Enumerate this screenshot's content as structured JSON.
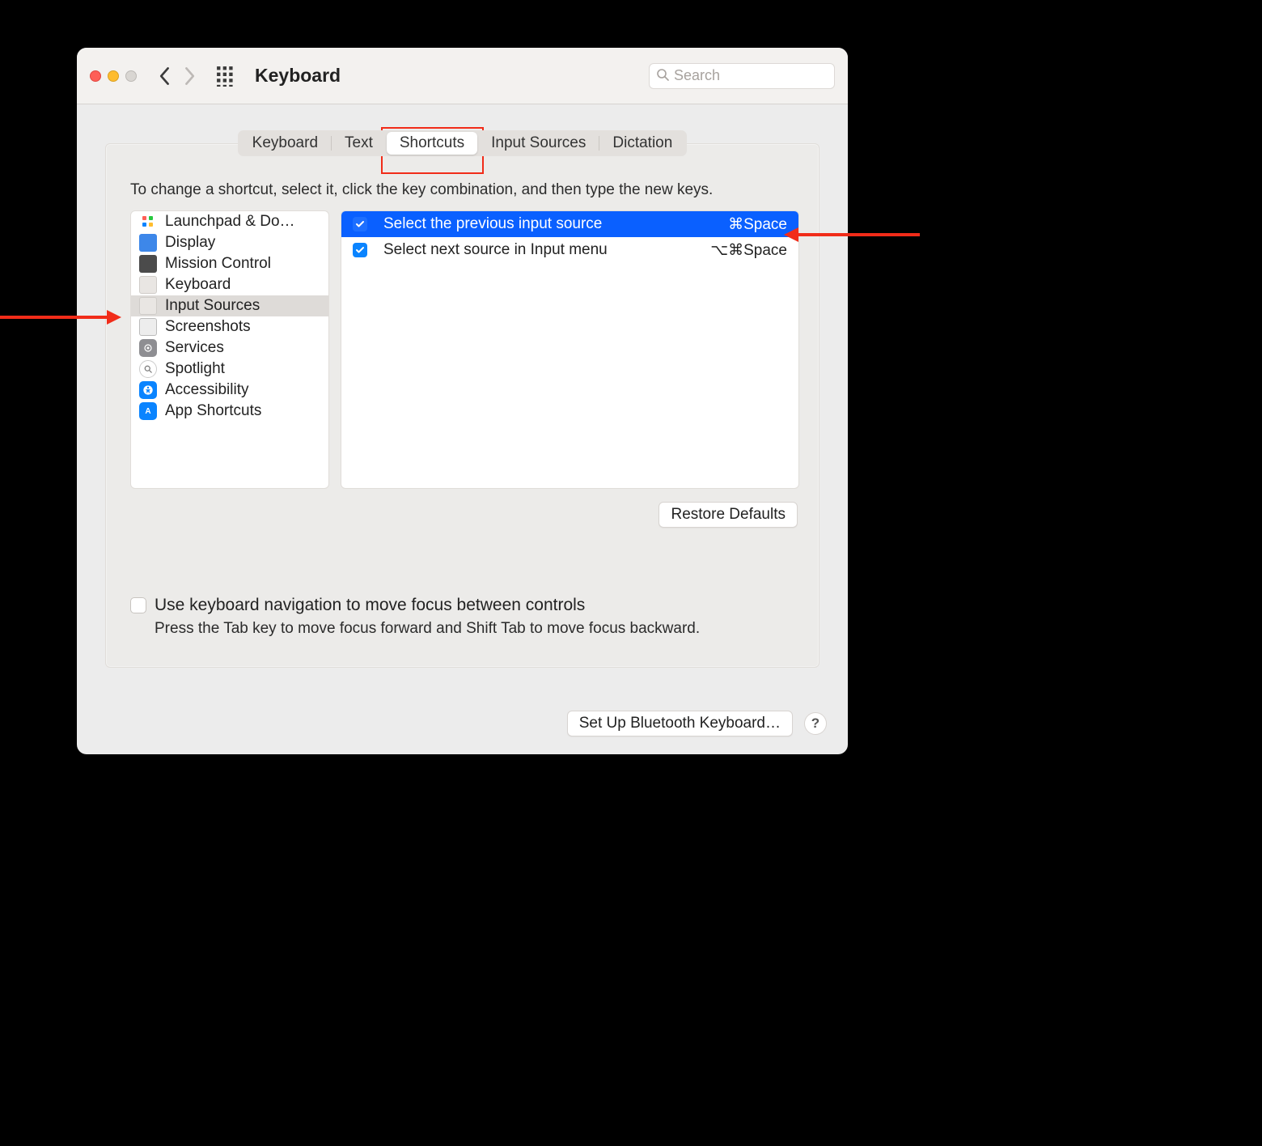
{
  "window": {
    "title": "Keyboard"
  },
  "search": {
    "placeholder": "Search"
  },
  "tabs": [
    {
      "label": "Keyboard",
      "selected": false
    },
    {
      "label": "Text",
      "selected": false
    },
    {
      "label": "Shortcuts",
      "selected": true
    },
    {
      "label": "Input Sources",
      "selected": false
    },
    {
      "label": "Dictation",
      "selected": false
    }
  ],
  "instruction": "To change a shortcut, select it, click the key combination, and then type the new keys.",
  "sidebar": {
    "items": [
      {
        "label": "Launchpad & Do…",
        "icon": "launchpad",
        "selected": false
      },
      {
        "label": "Display",
        "icon": "display",
        "selected": false
      },
      {
        "label": "Mission Control",
        "icon": "mc",
        "selected": false
      },
      {
        "label": "Keyboard",
        "icon": "keyboard",
        "selected": false
      },
      {
        "label": "Input Sources",
        "icon": "keyboard",
        "selected": true
      },
      {
        "label": "Screenshots",
        "icon": "screens",
        "selected": false
      },
      {
        "label": "Services",
        "icon": "services",
        "selected": false
      },
      {
        "label": "Spotlight",
        "icon": "spotlight",
        "selected": false
      },
      {
        "label": "Accessibility",
        "icon": "access",
        "selected": false
      },
      {
        "label": "App Shortcuts",
        "icon": "apps",
        "selected": false
      }
    ]
  },
  "detail": {
    "rows": [
      {
        "checked": true,
        "label": "Select the previous input source",
        "keys": "⌘Space",
        "selected": true
      },
      {
        "checked": true,
        "label": "Select next source in Input menu",
        "keys": "⌥⌘Space",
        "selected": false
      }
    ]
  },
  "restore": {
    "label": "Restore Defaults"
  },
  "kbnav": {
    "checkbox_label": "Use keyboard navigation to move focus between controls",
    "desc": "Press the Tab key to move focus forward and Shift Tab to move focus backward."
  },
  "footer": {
    "bluetooth": "Set Up Bluetooth Keyboard…",
    "help": "?"
  }
}
